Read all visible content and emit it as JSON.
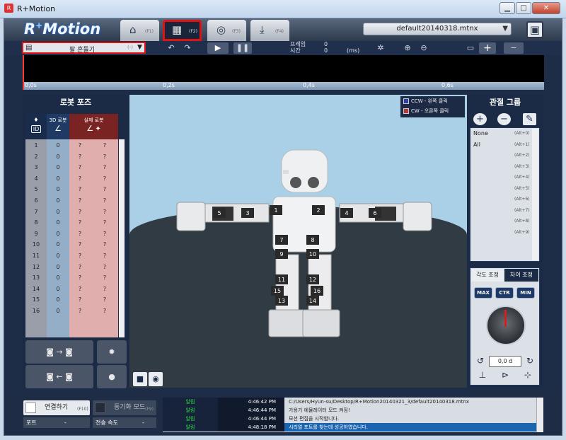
{
  "window": {
    "title": "R+Motion"
  },
  "app": {
    "logo_main": "R",
    "logo_sup": "+",
    "logo_rest": "Motion"
  },
  "tabs": [
    {
      "key": "(F1)",
      "icon": "home-icon"
    },
    {
      "key": "(F2)",
      "icon": "film-icon"
    },
    {
      "key": "(F3)",
      "icon": "reel-icon"
    },
    {
      "key": "(F4)",
      "icon": "download-icon"
    }
  ],
  "file": {
    "name": "default20140318.mtnx"
  },
  "toolbar": {
    "motion_name": "팔 흔들기",
    "motion_id": "(-)",
    "frame_label": "프레임",
    "frame_value": "0",
    "time_label": "시간",
    "time_value": "0",
    "time_unit": "(ms)"
  },
  "timeline": {
    "ticks": [
      "0,0s",
      "0,2s",
      "0,4s",
      "0,6s"
    ]
  },
  "left_panel": {
    "title": "로봇 포즈",
    "col_3d": "3D 로봇",
    "col_real": "실제 로봇",
    "id_badge": "ID",
    "rows": [
      {
        "id": "1",
        "v3d": "0",
        "a": "?",
        "b": "?"
      },
      {
        "id": "2",
        "v3d": "0",
        "a": "?",
        "b": "?"
      },
      {
        "id": "3",
        "v3d": "0",
        "a": "?",
        "b": "?"
      },
      {
        "id": "4",
        "v3d": "0",
        "a": "?",
        "b": "?"
      },
      {
        "id": "5",
        "v3d": "0",
        "a": "?",
        "b": "?"
      },
      {
        "id": "6",
        "v3d": "0",
        "a": "?",
        "b": "?"
      },
      {
        "id": "7",
        "v3d": "0",
        "a": "?",
        "b": "?"
      },
      {
        "id": "8",
        "v3d": "0",
        "a": "?",
        "b": "?"
      },
      {
        "id": "9",
        "v3d": "0",
        "a": "?",
        "b": "?"
      },
      {
        "id": "10",
        "v3d": "0",
        "a": "?",
        "b": "?"
      },
      {
        "id": "11",
        "v3d": "0",
        "a": "?",
        "b": "?"
      },
      {
        "id": "12",
        "v3d": "0",
        "a": "?",
        "b": "?"
      },
      {
        "id": "13",
        "v3d": "0",
        "a": "?",
        "b": "?"
      },
      {
        "id": "14",
        "v3d": "0",
        "a": "?",
        "b": "?"
      },
      {
        "id": "15",
        "v3d": "0",
        "a": "?",
        "b": "?"
      },
      {
        "id": "16",
        "v3d": "0",
        "a": "?",
        "b": "?"
      }
    ]
  },
  "viewport": {
    "legend_ccw": "CCW - 왼쪽 클릭",
    "legend_cw": "CW - 오른쪽 클릭",
    "ccw_color": "#2f3fa8",
    "cw_color": "#b33a3a"
  },
  "right_panel": {
    "title": "관절 그룹",
    "groups": [
      {
        "name": "None",
        "key": "(Alt+0)"
      },
      {
        "name": "All",
        "key": "(Alt+1)"
      },
      {
        "name": "",
        "key": "(Alt+2)"
      },
      {
        "name": "",
        "key": "(Alt+3)"
      },
      {
        "name": "",
        "key": "(Alt+4)"
      },
      {
        "name": "",
        "key": "(Alt+5)"
      },
      {
        "name": "",
        "key": "(Alt+6)"
      },
      {
        "name": "",
        "key": "(Alt+7)"
      },
      {
        "name": "",
        "key": "(Alt+8)"
      },
      {
        "name": "",
        "key": "(Alt+9)"
      }
    ],
    "tab_angle": "각도 조정",
    "tab_diff": "차이 조정",
    "btn_max": "MAX",
    "btn_ctr": "CTR",
    "btn_min": "MIN",
    "angle_value": "0,0 d"
  },
  "bottom": {
    "connect_label": "연결하기",
    "connect_key": "(F10)",
    "sync_label": "동기화 모드",
    "sync_key": "(F9)",
    "port_label": "포트",
    "port_value": "-",
    "speed_label": "전송 속도",
    "speed_value": "-"
  },
  "log": [
    {
      "tag": "알림",
      "time": "4:46:42 PM",
      "msg": "C:/Users/Hyun-su/Desktop/R+Motion20140321_3/default20140318.mtnx"
    },
    {
      "tag": "알림",
      "time": "4:46:44 PM",
      "msg": "가용기 에뮬레이터 모드 켜짐!"
    },
    {
      "tag": "알림",
      "time": "4:46:44 PM",
      "msg": "모션 편집을 시작합니다."
    },
    {
      "tag": "알림",
      "time": "4:48:18 PM",
      "msg": "시리얼 포트를 찾는데 성공하였습니다."
    }
  ],
  "robot_labels": [
    "1",
    "2",
    "3",
    "4",
    "5",
    "6",
    "7",
    "8",
    "9",
    "10",
    "11",
    "12",
    "13",
    "14",
    "15",
    "16"
  ]
}
